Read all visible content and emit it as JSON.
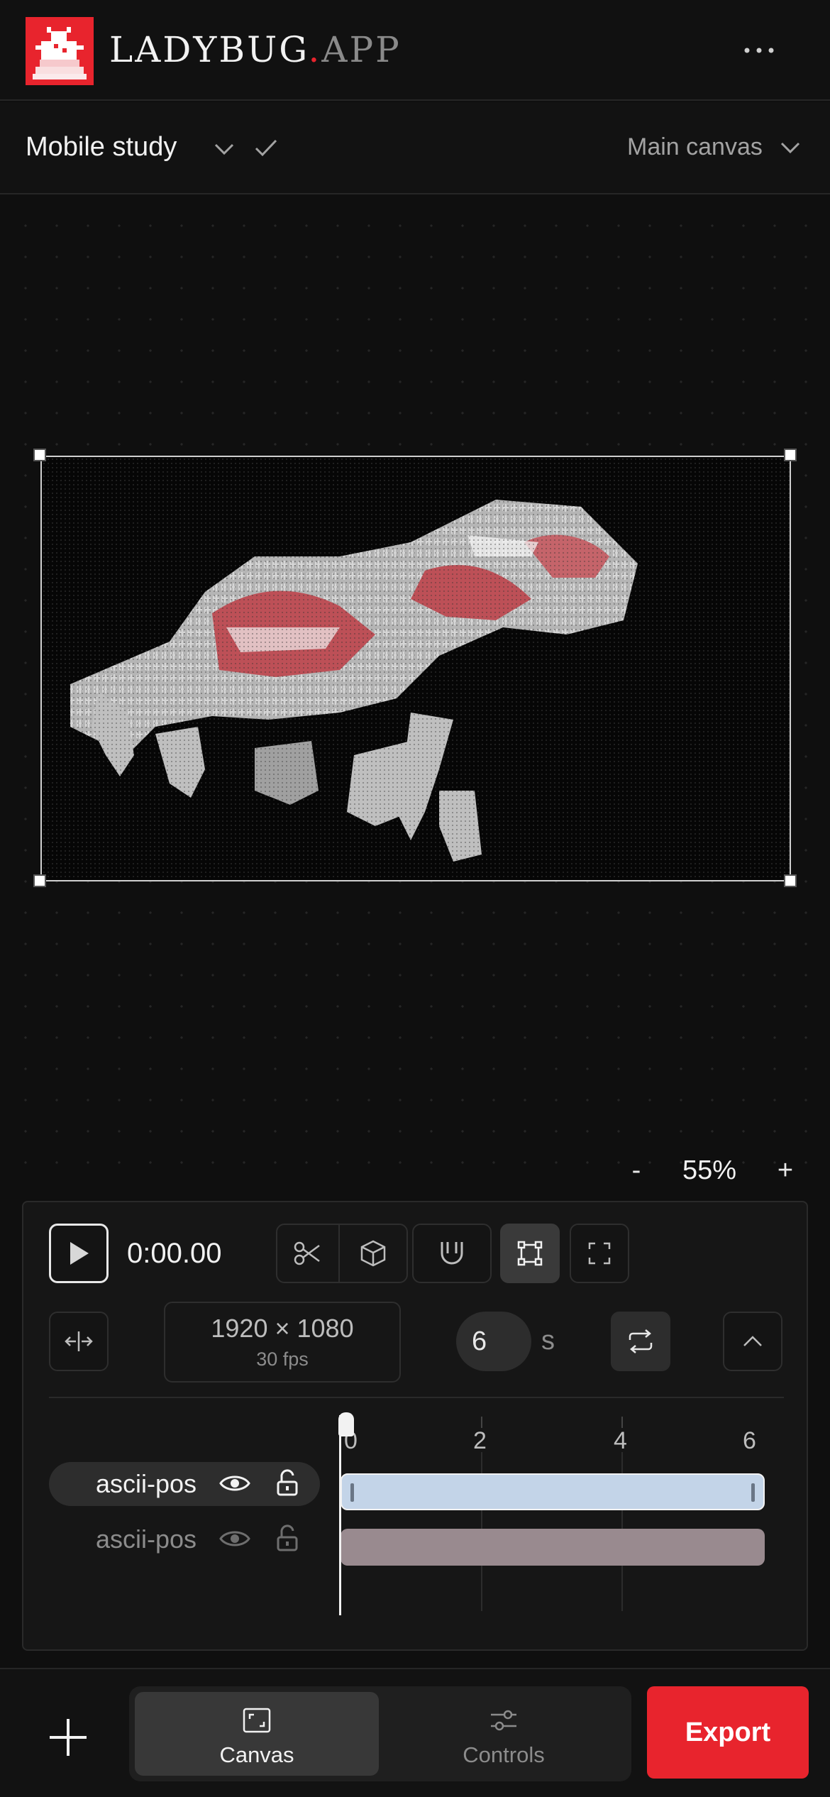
{
  "brand": {
    "name_main": "LADYBUG",
    "name_dot": ".",
    "name_tld": "APP"
  },
  "header": {
    "more_icon": "more-horizontal-icon"
  },
  "project": {
    "name": "Mobile study",
    "canvas": "Main canvas"
  },
  "zoom": {
    "minus": "-",
    "value": "55%",
    "plus": "+"
  },
  "playback": {
    "time": "0:00.00"
  },
  "toolbar": {
    "icons": [
      "scissors-icon",
      "cube-icon",
      "magnet-icon",
      "transform-icon",
      "fullscreen-icon"
    ],
    "active": "transform-icon"
  },
  "canvas_settings": {
    "dimensions": "1920 × 1080",
    "fps": "30 fps",
    "duration": "6",
    "duration_unit": "s"
  },
  "timeline": {
    "ruler": [
      "0",
      "2",
      "4",
      "6"
    ],
    "layers": [
      {
        "name": "ascii-pos",
        "visible": true,
        "locked": false,
        "selected": true,
        "clip_color": "#c3d4e8"
      },
      {
        "name": "ascii-pos",
        "visible": true,
        "locked": false,
        "selected": false,
        "clip_color": "#998a8f"
      }
    ]
  },
  "bottom_nav": {
    "add_icon": "plus-icon",
    "tabs": [
      {
        "label": "Canvas",
        "icon": "canvas-icon",
        "active": true
      },
      {
        "label": "Controls",
        "icon": "sliders-icon",
        "active": false
      }
    ],
    "export_label": "Export"
  },
  "colors": {
    "accent": "#e8242d",
    "background": "#0f0f0f",
    "panel": "#161616",
    "clip_primary": "#c3d4e8",
    "clip_secondary": "#998a8f"
  }
}
